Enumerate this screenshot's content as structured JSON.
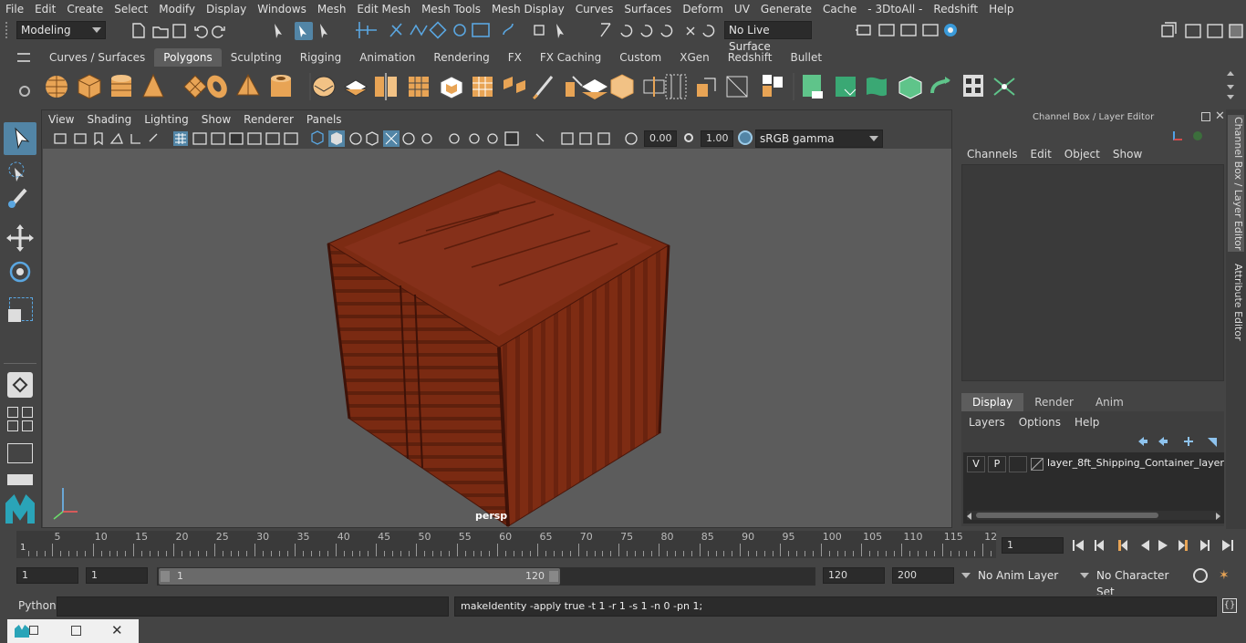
{
  "menubar": [
    "File",
    "Edit",
    "Create",
    "Select",
    "Modify",
    "Display",
    "Windows",
    "Mesh",
    "Edit Mesh",
    "Mesh Tools",
    "Mesh Display",
    "Curves",
    "Surfaces",
    "Deform",
    "UV",
    "Generate",
    "Cache",
    "- 3DtoAll -",
    "Redshift",
    "Help"
  ],
  "status": {
    "mode": "Modeling",
    "live_surface": "No Live Surface"
  },
  "shelf_tabs": [
    "Curves / Surfaces",
    "Polygons",
    "Sculpting",
    "Rigging",
    "Animation",
    "Rendering",
    "FX",
    "FX Caching",
    "Custom",
    "XGen",
    "Redshift",
    "Bullet"
  ],
  "shelf_active": "Polygons",
  "viewport": {
    "menu": [
      "View",
      "Shading",
      "Lighting",
      "Show",
      "Renderer",
      "Panels"
    ],
    "exposure": "0.00",
    "gamma": "1.00",
    "color_space": "sRGB gamma",
    "camera_label": "persp"
  },
  "channel_box": {
    "title": "Channel Box / Layer Editor",
    "menu": [
      "Channels",
      "Edit",
      "Object",
      "Show"
    ],
    "tabs": [
      "Display",
      "Render",
      "Anim"
    ],
    "active_tab": "Display",
    "layer_menu": [
      "Layers",
      "Options",
      "Help"
    ],
    "layer": {
      "v": "V",
      "p": "P",
      "name": "layer_8ft_Shipping_Container_layer"
    }
  },
  "side_tabs": [
    "Channel Box / Layer Editor",
    "Attribute Editor"
  ],
  "timeline": {
    "ticks": [
      "5",
      "10",
      "15",
      "20",
      "25",
      "30",
      "35",
      "40",
      "45",
      "50",
      "55",
      "60",
      "65",
      "70",
      "75",
      "80",
      "85",
      "90",
      "95",
      "100",
      "105",
      "110",
      "115",
      "12"
    ],
    "start_marker": "1",
    "current_frame": "1"
  },
  "range": {
    "start": "1",
    "playback_start": "1",
    "slider_start": "1",
    "slider_end": "120",
    "playback_end": "120",
    "end": "200",
    "anim_layer": "No Anim Layer",
    "character_set": "No Character Set"
  },
  "command": {
    "language": "Python",
    "output": "makeIdentity -apply true -t 1 -r 1 -s 1 -n 0 -pn 1;"
  },
  "colors": {
    "bg": "#444444",
    "viewport": "#5c5c5c",
    "container": "#7a2a12",
    "accent": "#5285a6"
  }
}
